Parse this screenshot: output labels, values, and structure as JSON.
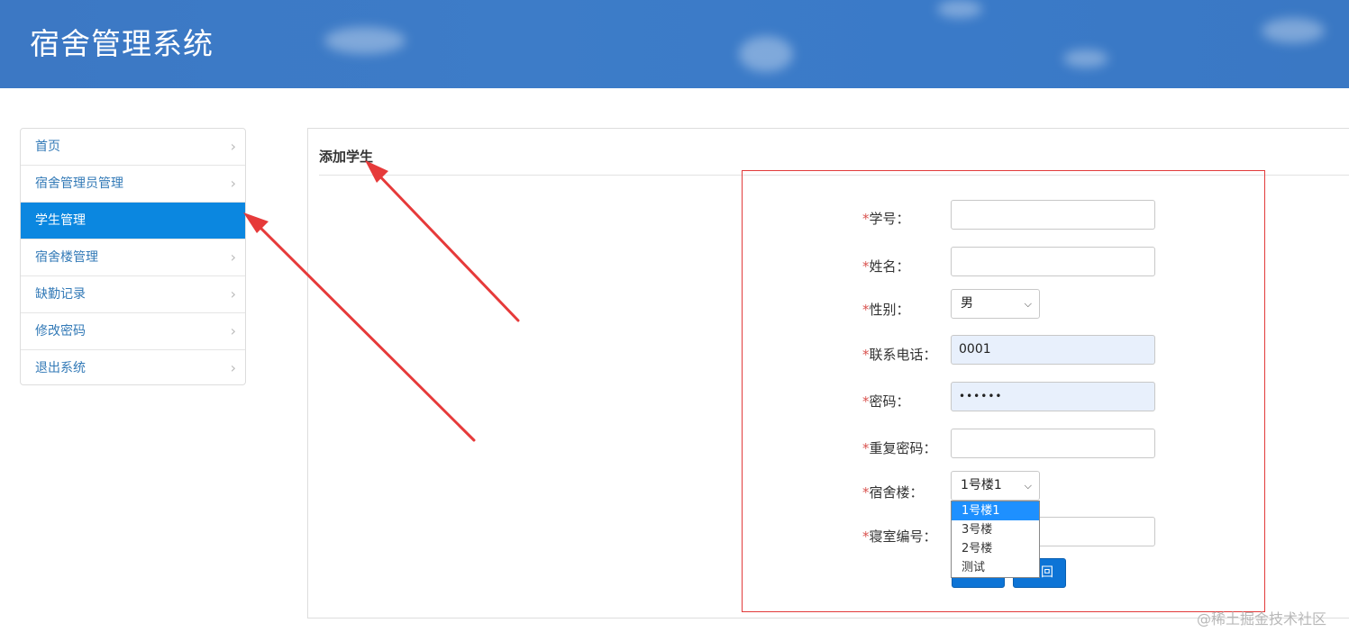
{
  "app": {
    "title": "宿舍管理系统"
  },
  "sidebar": {
    "items": [
      {
        "label": "首页",
        "active": false
      },
      {
        "label": "宿舍管理员管理",
        "active": false
      },
      {
        "label": "学生管理",
        "active": true
      },
      {
        "label": "宿舍楼管理",
        "active": false
      },
      {
        "label": "缺勤记录",
        "active": false
      },
      {
        "label": "修改密码",
        "active": false
      },
      {
        "label": "退出系统",
        "active": false
      }
    ],
    "chevron": "›"
  },
  "panel": {
    "title": "添加学生"
  },
  "form": {
    "required_mark": "*",
    "student_id": {
      "label": "学号：",
      "value": ""
    },
    "name": {
      "label": "姓名：",
      "value": ""
    },
    "gender": {
      "label": "性别：",
      "value": "男"
    },
    "phone": {
      "label": "联系电话：",
      "value": "0001"
    },
    "password": {
      "label": "密码：",
      "value": "••••••"
    },
    "repeat_password": {
      "label": "重复密码：",
      "value": ""
    },
    "building": {
      "label": "宿舍楼：",
      "value": "1号楼1",
      "options": [
        "1号楼1",
        "3号楼",
        "2号楼",
        "测试"
      ]
    },
    "room": {
      "label": "寝室编号：",
      "value": ""
    },
    "back_button_partial": "回"
  },
  "watermark": "@稀土掘金技术社区",
  "colors": {
    "header_bg": "#3c78c4",
    "active_item": "#0b87e0",
    "annotation": "#e23b3b",
    "button": "#0d74d6"
  },
  "icons": {
    "select_arrow": "chevron-down-icon"
  }
}
